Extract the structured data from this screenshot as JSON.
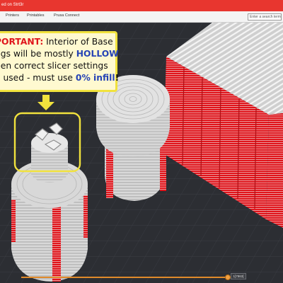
{
  "window": {
    "title": "ed on Strt3r"
  },
  "menu": {
    "tabs": [
      "Printers",
      "Printables",
      "Prusa Connect"
    ],
    "search_placeholder": "Enter a search term"
  },
  "callout": {
    "line1_red": "PORTANT:",
    "line1_rest": " Interior of Base",
    "line2_pre": "ngs will be mostly ",
    "line2_blue": "HOLLOW",
    "line3": "hen correct slicer settings",
    "line4_pre": "e used - must use ",
    "line4_blue": "0% infill",
    "line4_post": "!"
  },
  "slider": {
    "layer_value": "1[7863]"
  },
  "colors": {
    "title_bar": "#e8362f",
    "highlight": "#f1e23d",
    "accent_orange": "#e08a2a",
    "perimeter_red": "#e0141b"
  }
}
